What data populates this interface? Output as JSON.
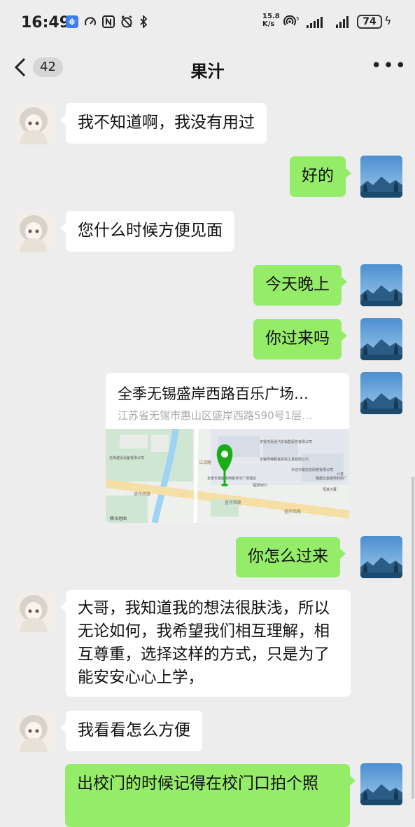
{
  "status": {
    "time": "16:49",
    "net_speed_value": "15.8",
    "net_speed_unit": "K/s",
    "battery": "74"
  },
  "nav": {
    "unread_count": "42",
    "title": "果汁"
  },
  "messages": [
    {
      "side": "left",
      "text": "我不知道啊，我没有用过"
    },
    {
      "side": "right",
      "text": "好的"
    },
    {
      "side": "left",
      "text": "您什么时候方便见面"
    },
    {
      "side": "right",
      "text": "今天晚上"
    },
    {
      "side": "right",
      "text": "你过来吗"
    },
    {
      "side": "right",
      "type": "location",
      "name": "全季无锡盛岸西路百乐广场…",
      "address": "江苏省无锡市惠山区盛岸西路590号1层…"
    },
    {
      "side": "right",
      "text": "你怎么过来"
    },
    {
      "side": "left",
      "text": "大哥，我知道我的想法很肤浅，所以无论如何，我希望我们相互理解，相互尊重，选择这样的方式，只是为了能安安心心上学，"
    },
    {
      "side": "left",
      "text": "我看看怎么方便"
    },
    {
      "side": "right",
      "text": "出校门的时候记得在校门口拍个照"
    }
  ],
  "map": {
    "road_1": "盛岸西路",
    "road_2": "盛岸西路",
    "road_3": "盛岸西路",
    "road_4": "江湾路",
    "poi_1": "无锡市惠通汽车销售服务有限公司",
    "poi_2": "无锡市特耐克农机工具有限公司",
    "poi_3": "华佳华银信息网络有限公司",
    "poi_4": "锡都五金装饰材料广",
    "poi_5": "恒基大厦",
    "poi_6": "先锋建设设备有限公司",
    "poi_7": "全季无锡盛岸西路百乐广场酒店",
    "poi_8": "福源NEO",
    "poi_9": "六发",
    "logo": "腾讯地图"
  },
  "colors": {
    "my_bubble": "#95ec69",
    "their_bubble": "#ffffff",
    "background": "#ededed",
    "map_pin": "#1aad19"
  }
}
